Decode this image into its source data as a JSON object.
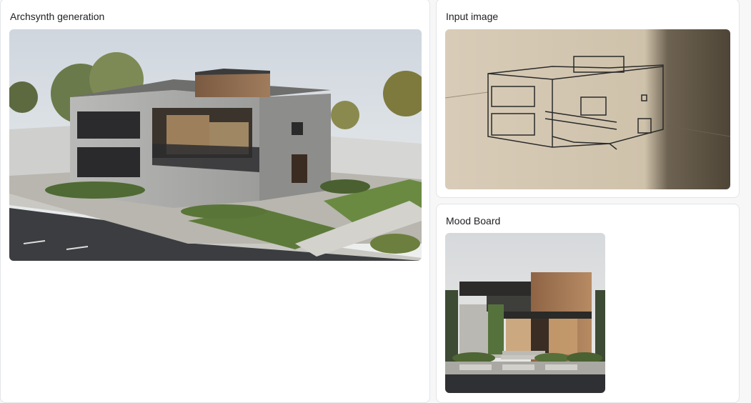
{
  "panels": {
    "generation": {
      "title": "Archsynth generation"
    },
    "input": {
      "title": "Input image"
    },
    "mood": {
      "title": "Mood Board"
    }
  },
  "colors": {
    "panel_bg": "#ffffff",
    "panel_border": "#e3e4e8",
    "page_bg": "#f7f7f8"
  }
}
